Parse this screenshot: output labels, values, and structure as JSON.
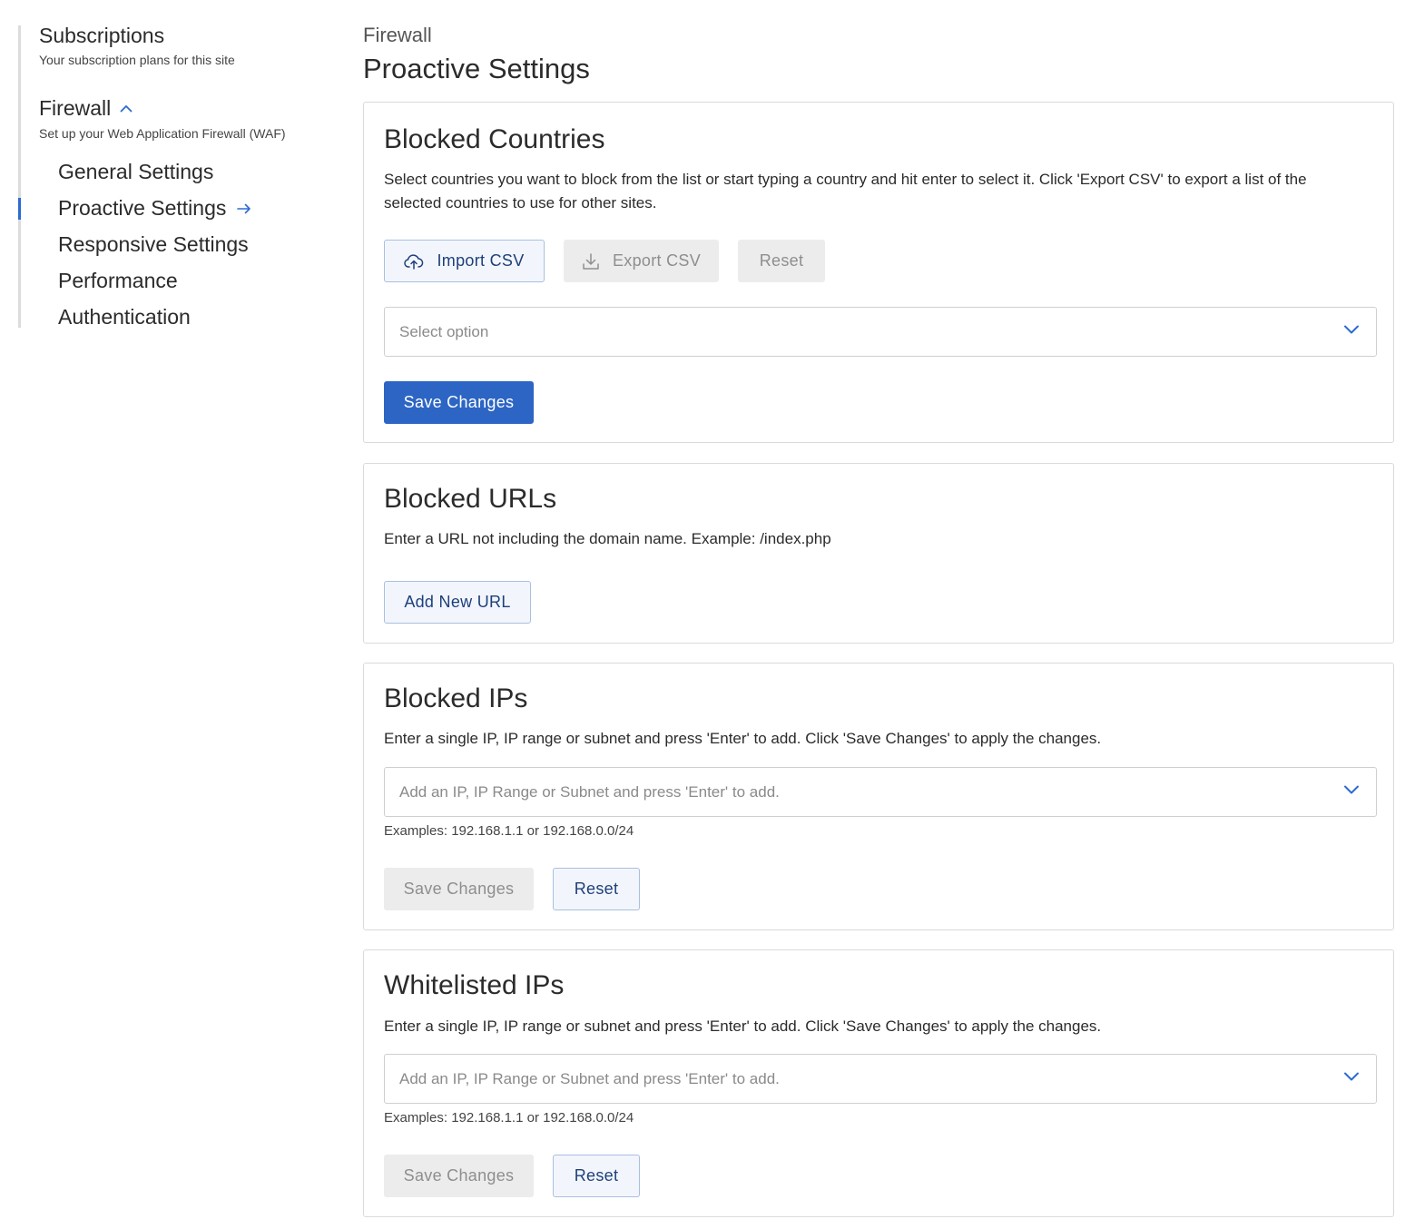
{
  "sidebar": {
    "subscriptions": {
      "title": "Subscriptions",
      "subtitle": "Your subscription plans for this site"
    },
    "firewall": {
      "title": "Firewall",
      "subtitle": "Set up your Web Application Firewall (WAF)"
    },
    "items": [
      {
        "label": "General Settings",
        "active": false
      },
      {
        "label": "Proactive Settings",
        "active": true
      },
      {
        "label": "Responsive Settings",
        "active": false
      },
      {
        "label": "Performance",
        "active": false
      },
      {
        "label": "Authentication",
        "active": false
      }
    ]
  },
  "header": {
    "breadcrumb": "Firewall",
    "title": "Proactive Settings"
  },
  "blocked_countries": {
    "title": "Blocked Countries",
    "description": "Select countries you want to block from the list or start typing a country and hit enter to select it. Click 'Export CSV' to export a list of the selected countries to use for other sites.",
    "import_label": "Import CSV",
    "export_label": "Export CSV",
    "reset_label": "Reset",
    "select_placeholder": "Select option",
    "save_label": "Save Changes"
  },
  "blocked_urls": {
    "title": "Blocked URLs",
    "description": "Enter a URL not including the domain name. Example: /index.php",
    "add_label": "Add New URL"
  },
  "blocked_ips": {
    "title": "Blocked IPs",
    "description": "Enter a single IP, IP range or subnet and press 'Enter' to add. Click 'Save Changes' to apply the changes.",
    "placeholder": "Add an IP, IP Range or Subnet and press 'Enter' to add.",
    "hint": "Examples: 192.168.1.1 or 192.168.0.0/24",
    "save_label": "Save Changes",
    "reset_label": "Reset"
  },
  "whitelisted_ips": {
    "title": "Whitelisted IPs",
    "description": "Enter a single IP, IP range or subnet and press 'Enter' to add. Click 'Save Changes' to apply the changes.",
    "placeholder": "Add an IP, IP Range or Subnet and press 'Enter' to add.",
    "hint": "Examples: 192.168.1.1 or 192.168.0.0/24",
    "save_label": "Save Changes",
    "reset_label": "Reset"
  },
  "colors": {
    "accent": "#2d65c4",
    "outline_bg": "#f2f6fc",
    "disabled_bg": "#ececec",
    "border": "#dadada"
  },
  "icons": {
    "firewall_toggle": "chevron-up-icon",
    "active_indicator": "arrow-right-icon",
    "import": "cloud-upload-icon",
    "export": "download-icon",
    "dropdown": "chevron-down-icon"
  }
}
